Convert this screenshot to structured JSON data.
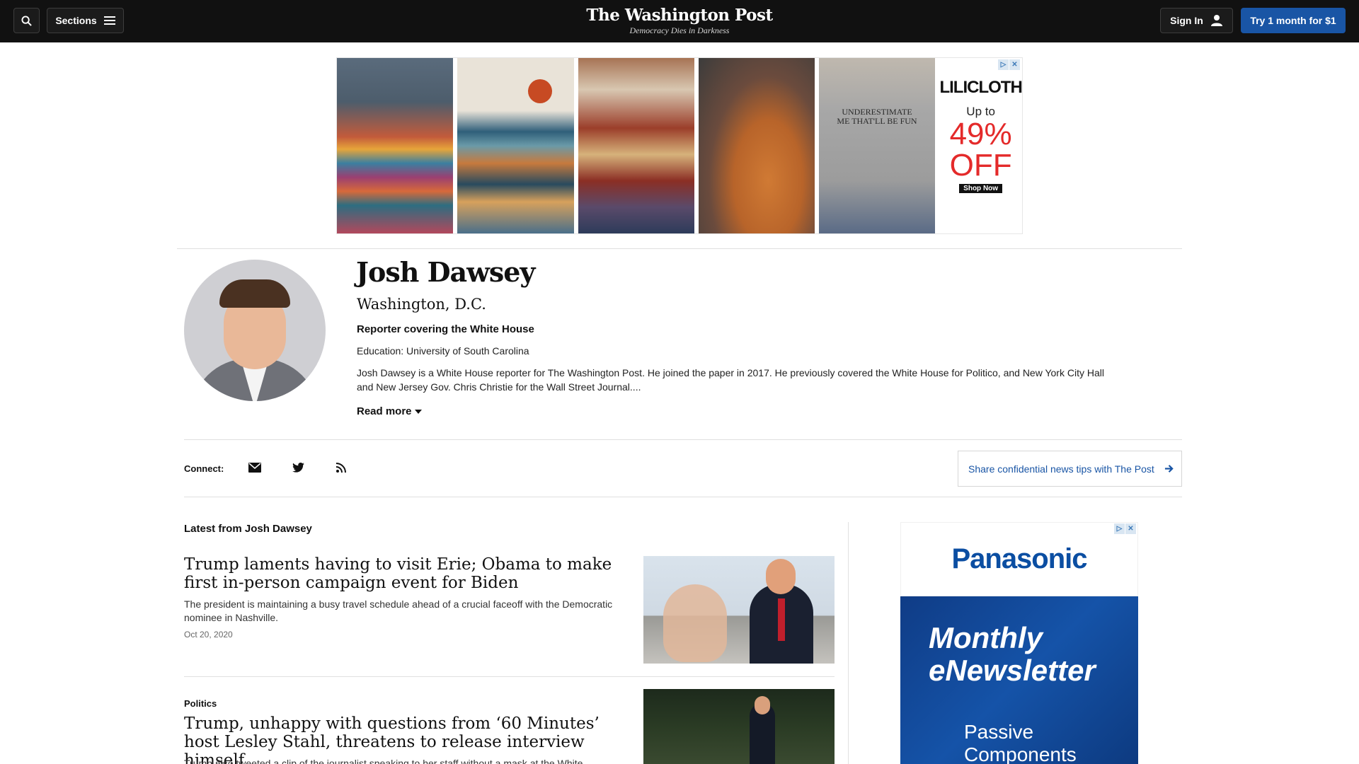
{
  "header": {
    "sections_label": "Sections",
    "logo_title": "The Washington Post",
    "logo_tagline": "Democracy Dies in Darkness",
    "signin_label": "Sign In",
    "subscribe_label": "Try 1 month for $1"
  },
  "top_ad": {
    "tile5_text": "UNDERESTIMATE ME THAT'LL BE FUN",
    "brand": "LILICLOTH",
    "upto": "Up to",
    "percent": "49%",
    "off": "OFF",
    "cta": "Shop Now"
  },
  "author": {
    "name": "Josh Dawsey",
    "location": "Washington, D.C.",
    "role": "Reporter covering the White House",
    "education": "Education: University of South Carolina",
    "bio": "Josh Dawsey is a White House reporter for The Washington Post. He joined the paper in 2017. He previously covered the White House for Politico, and New York City Hall and New Jersey Gov. Chris Christie for the Wall Street Journal....",
    "read_more": "Read more"
  },
  "connect": {
    "label": "Connect:",
    "tips": "Share confidential news tips with The Post"
  },
  "latest": {
    "heading": "Latest from Josh Dawsey",
    "stories": [
      {
        "kicker": "",
        "title": "Trump laments having to visit Erie; Obama to make first in-person campaign event for Biden",
        "blurb": "The president is maintaining a busy travel schedule ahead of a crucial faceoff with the Democratic nominee in Nashville.",
        "date": "Oct 20, 2020"
      },
      {
        "kicker": "Politics",
        "title": "Trump, unhappy with questions from ‘60 Minutes’ host Lesley Stahl, threatens to release interview himself",
        "blurb": "Trump also tweeted a clip of the journalist speaking to her staff without a mask at the White",
        "date": ""
      }
    ]
  },
  "side_ad": {
    "brand": "Panasonic",
    "headline": "Monthly eNewsletter",
    "sub": "Passive Components"
  },
  "colors": {
    "topbar": "#111111",
    "accent_blue": "#1955a5",
    "ad_red": "#e42a2a"
  },
  "icons": [
    "search-icon",
    "hamburger-icon",
    "user-icon",
    "caret-down-icon",
    "email-icon",
    "twitter-icon",
    "rss-icon",
    "arrow-right-icon",
    "adchoices-icon",
    "close-icon"
  ]
}
